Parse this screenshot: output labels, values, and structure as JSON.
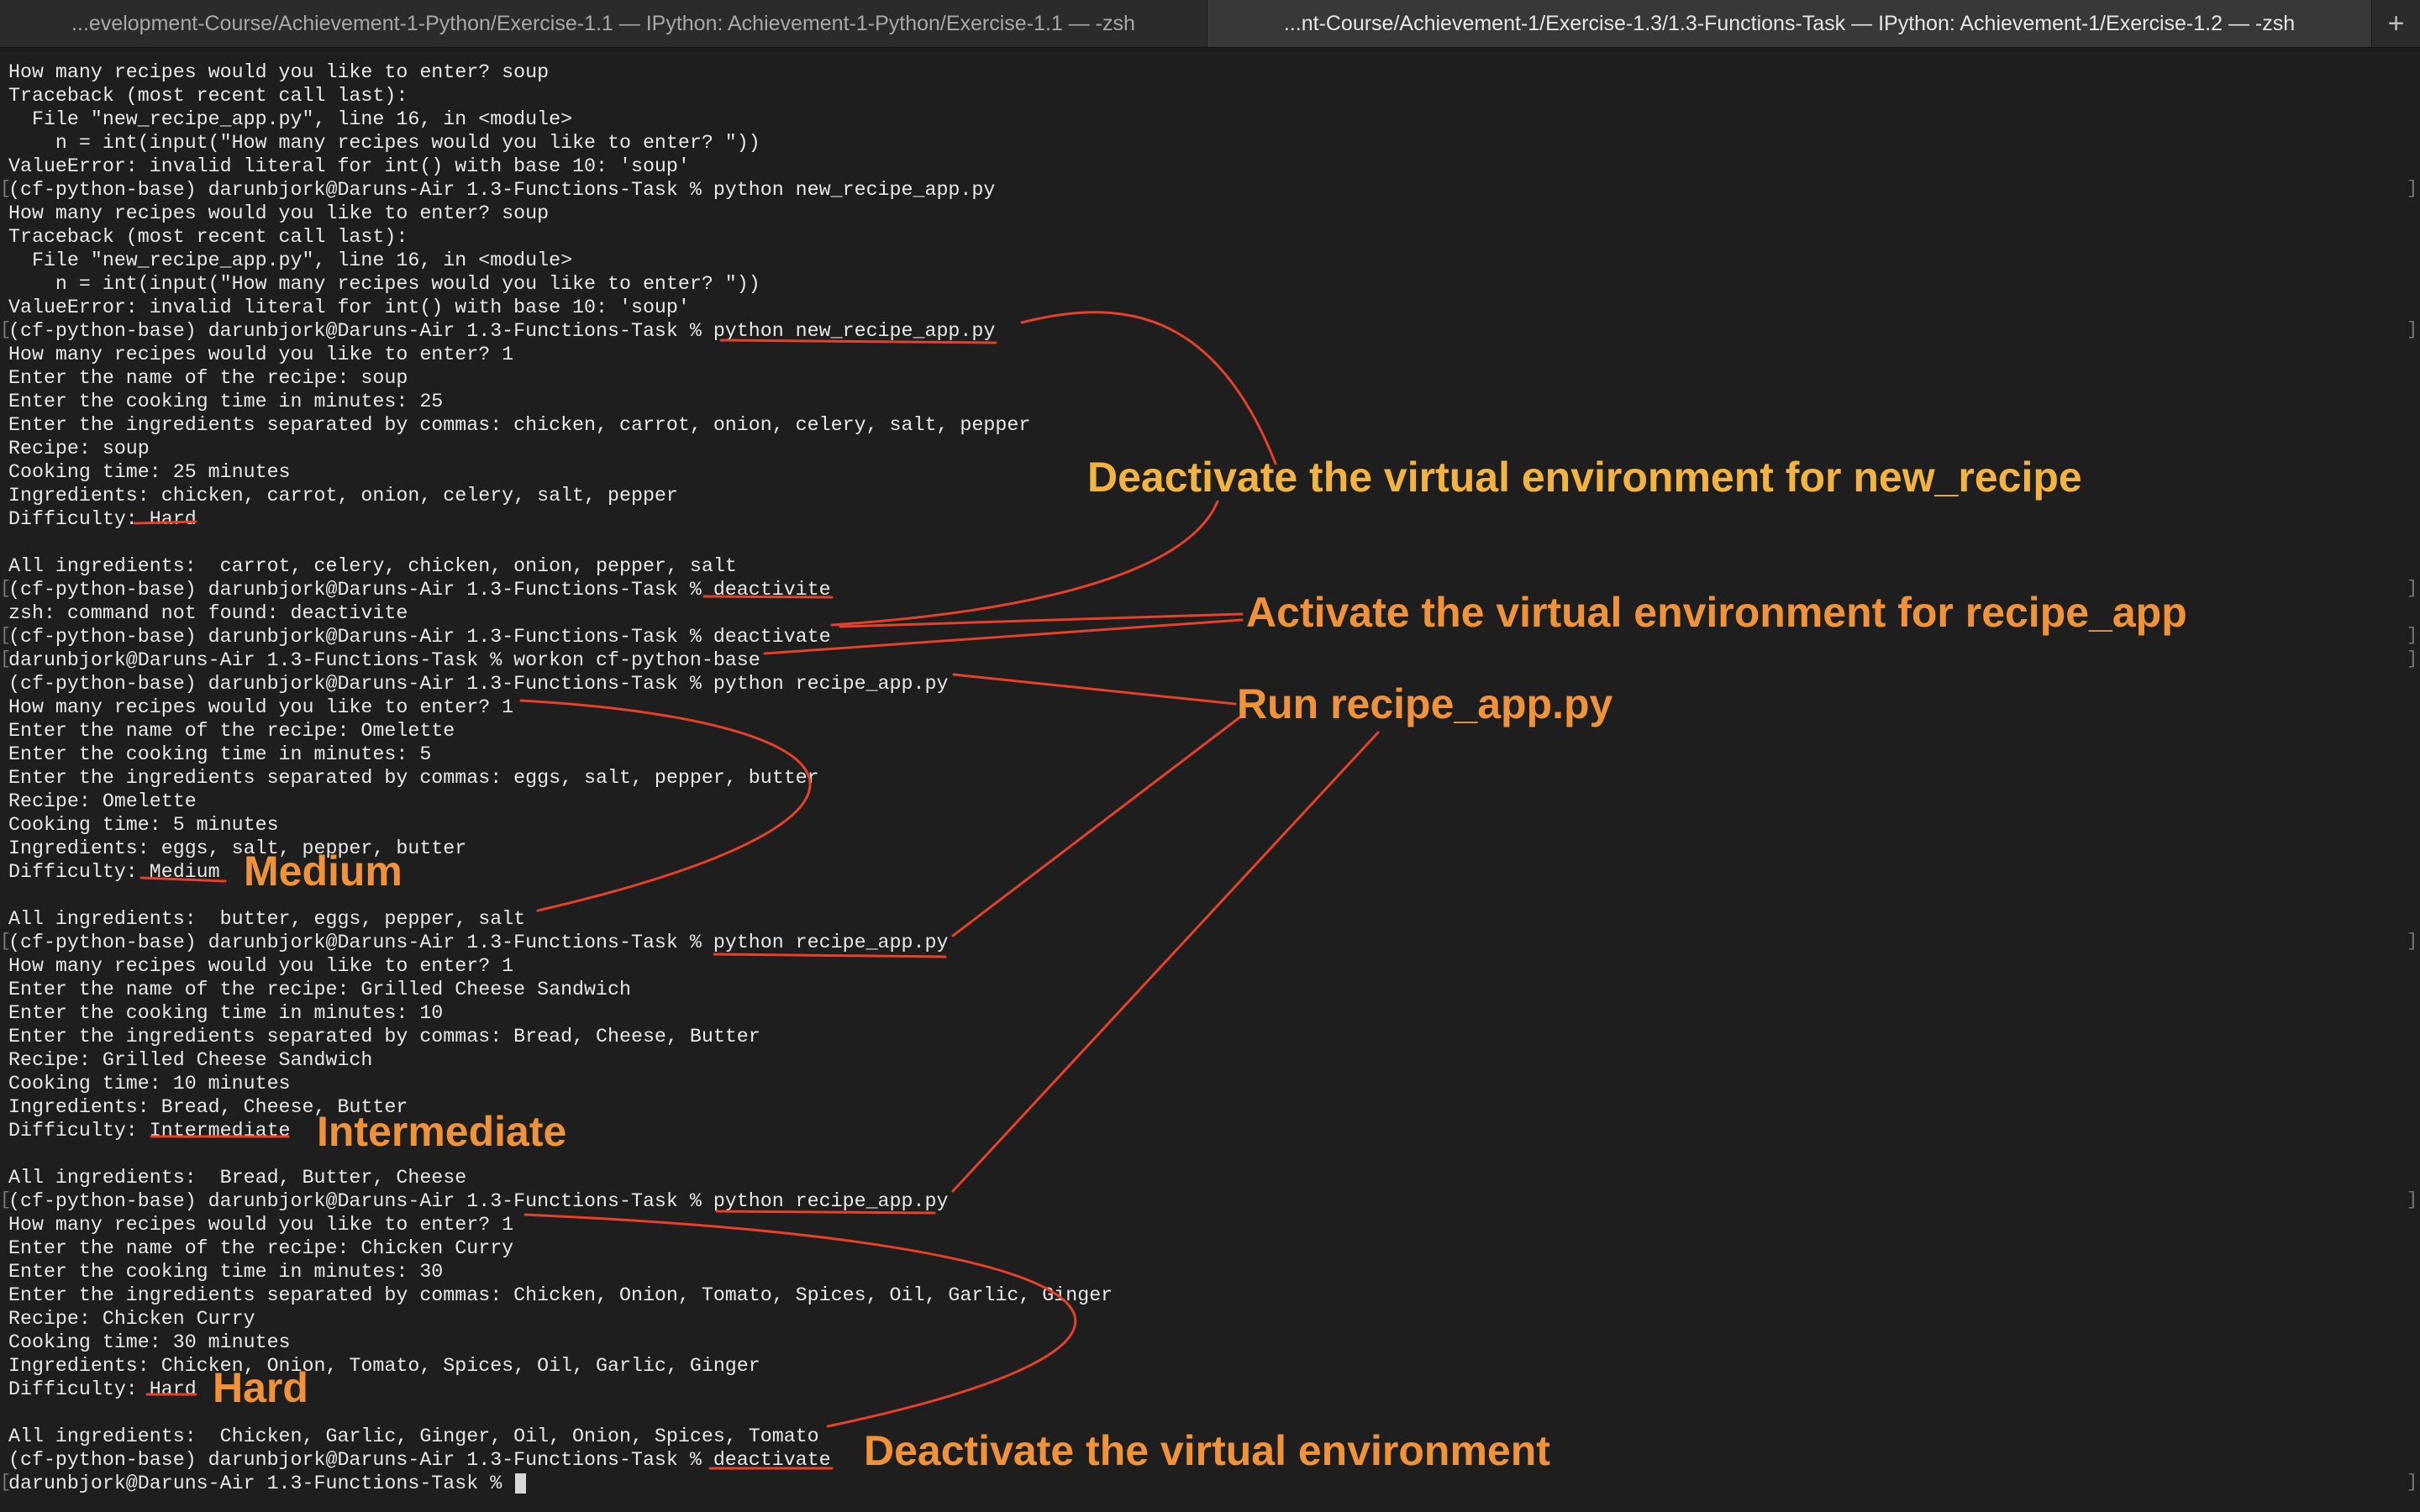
{
  "tabs": [
    {
      "title": "...evelopment-Course/Achievement-1-Python/Exercise-1.1 — IPython: Achievement-1-Python/Exercise-1.1 — -zsh"
    },
    {
      "title": "...nt-Course/Achievement-1/Exercise-1.3/1.3-Functions-Task — IPython: Achievement-1/Exercise-1.2 — -zsh"
    }
  ],
  "new_tab_label": "+",
  "terminal": {
    "lines": [
      {
        "text": "How many recipes would you like to enter? soup"
      },
      {
        "text": "Traceback (most recent call last):"
      },
      {
        "text": "  File \"new_recipe_app.py\", line 16, in <module>"
      },
      {
        "text": "    n = int(input(\"How many recipes would you like to enter? \"))"
      },
      {
        "text": "ValueError: invalid literal for int() with base 10: 'soup'"
      },
      {
        "text": "(cf-python-base) darunbjork@Daruns-Air 1.3-Functions-Task % python new_recipe_app.py"
      },
      {
        "text": "How many recipes would you like to enter? soup"
      },
      {
        "text": "Traceback (most recent call last):"
      },
      {
        "text": "  File \"new_recipe_app.py\", line 16, in <module>"
      },
      {
        "text": "    n = int(input(\"How many recipes would you like to enter? \"))"
      },
      {
        "text": "ValueError: invalid literal for int() with base 10: 'soup'"
      },
      {
        "text": "(cf-python-base) darunbjork@Daruns-Air 1.3-Functions-Task % python new_recipe_app.py"
      },
      {
        "text": "How many recipes would you like to enter? 1"
      },
      {
        "text": "Enter the name of the recipe: soup"
      },
      {
        "text": "Enter the cooking time in minutes: 25"
      },
      {
        "text": "Enter the ingredients separated by commas: chicken, carrot, onion, celery, salt, pepper"
      },
      {
        "text": "Recipe: soup"
      },
      {
        "text": "Cooking time: 25 minutes"
      },
      {
        "text": "Ingredients: chicken, carrot, onion, celery, salt, pepper"
      },
      {
        "text": "Difficulty: Hard"
      },
      {
        "text": ""
      },
      {
        "text": "All ingredients:  carrot, celery, chicken, onion, pepper, salt"
      },
      {
        "text": "(cf-python-base) darunbjork@Daruns-Air 1.3-Functions-Task % deactivite"
      },
      {
        "text": "zsh: command not found: deactivite"
      },
      {
        "text": "(cf-python-base) darunbjork@Daruns-Air 1.3-Functions-Task % deactivate"
      },
      {
        "text": "darunbjork@Daruns-Air 1.3-Functions-Task % workon cf-python-base"
      },
      {
        "text": "(cf-python-base) darunbjork@Daruns-Air 1.3-Functions-Task % python recipe_app.py"
      },
      {
        "text": "How many recipes would you like to enter? 1"
      },
      {
        "text": "Enter the name of the recipe: Omelette"
      },
      {
        "text": "Enter the cooking time in minutes: 5"
      },
      {
        "text": "Enter the ingredients separated by commas: eggs, salt, pepper, butter"
      },
      {
        "text": "Recipe: Omelette"
      },
      {
        "text": "Cooking time: 5 minutes"
      },
      {
        "text": "Ingredients: eggs, salt, pepper, butter"
      },
      {
        "text": "Difficulty: Medium"
      },
      {
        "text": ""
      },
      {
        "text": "All ingredients:  butter, eggs, pepper, salt"
      },
      {
        "text": "(cf-python-base) darunbjork@Daruns-Air 1.3-Functions-Task % python recipe_app.py"
      },
      {
        "text": "How many recipes would you like to enter? 1"
      },
      {
        "text": "Enter the name of the recipe: Grilled Cheese Sandwich"
      },
      {
        "text": "Enter the cooking time in minutes: 10"
      },
      {
        "text": "Enter the ingredients separated by commas: Bread, Cheese, Butter"
      },
      {
        "text": "Recipe: Grilled Cheese Sandwich"
      },
      {
        "text": "Cooking time: 10 minutes"
      },
      {
        "text": "Ingredients: Bread, Cheese, Butter"
      },
      {
        "text": "Difficulty: Intermediate"
      },
      {
        "text": ""
      },
      {
        "text": "All ingredients:  Bread, Butter, Cheese"
      },
      {
        "text": "(cf-python-base) darunbjork@Daruns-Air 1.3-Functions-Task % python recipe_app.py"
      },
      {
        "text": "How many recipes would you like to enter? 1"
      },
      {
        "text": "Enter the name of the recipe: Chicken Curry"
      },
      {
        "text": "Enter the cooking time in minutes: 30"
      },
      {
        "text": "Enter the ingredients separated by commas: Chicken, Onion, Tomato, Spices, Oil, Garlic, Ginger"
      },
      {
        "text": "Recipe: Chicken Curry"
      },
      {
        "text": "Cooking time: 30 minutes"
      },
      {
        "text": "Ingredients: Chicken, Onion, Tomato, Spices, Oil, Garlic, Ginger"
      },
      {
        "text": "Difficulty: Hard"
      },
      {
        "text": ""
      },
      {
        "text": "All ingredients:  Chicken, Garlic, Ginger, Oil, Onion, Spices, Tomato"
      },
      {
        "text": "(cf-python-base) darunbjork@Daruns-Air 1.3-Functions-Task % deactivate"
      },
      {
        "text": "darunbjork@Daruns-Air 1.3-Functions-Task % "
      }
    ],
    "bracketed_lines": [
      5,
      11,
      22,
      24,
      25,
      37,
      48,
      60
    ]
  },
  "annotations": [
    {
      "text": "Deactivate the virtual environment for new_recipe"
    },
    {
      "text": "Activate the virtual environment for recipe_app"
    },
    {
      "text": "Run recipe_app.py"
    },
    {
      "text": "Medium"
    },
    {
      "text": "Intermediate"
    },
    {
      "text": "Hard"
    },
    {
      "text": "Deactivate the virtual environment"
    }
  ],
  "colors": {
    "background": "#1e1e1e",
    "text": "#e8e8e8",
    "annotation_yellow": "#f3b341",
    "annotation_orange": "#f0923a",
    "annotation_line": "#e5402a"
  }
}
